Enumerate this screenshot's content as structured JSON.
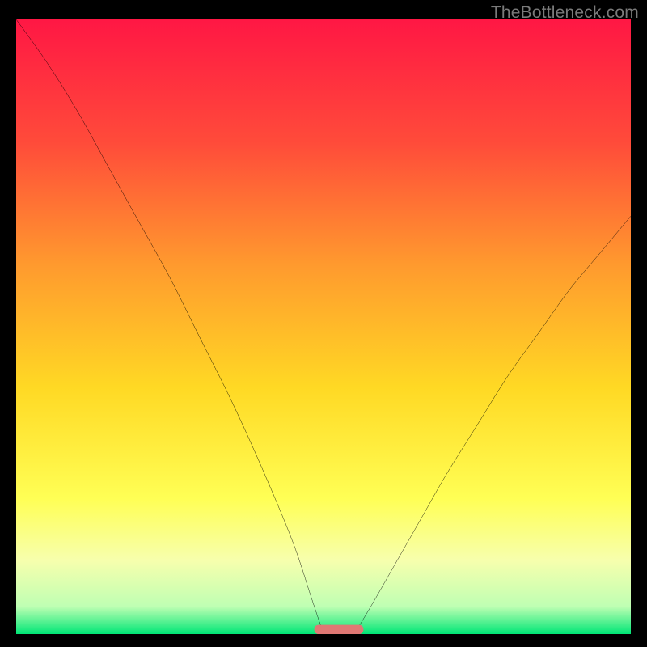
{
  "watermark": "TheBottleneck.com",
  "chart_data": {
    "type": "line",
    "title": "",
    "xlabel": "",
    "ylabel": "",
    "xlim": [
      0,
      100
    ],
    "ylim": [
      0,
      100
    ],
    "background_gradient": {
      "stops": [
        {
          "offset": 0.0,
          "color": "#ff1744"
        },
        {
          "offset": 0.2,
          "color": "#ff4b3a"
        },
        {
          "offset": 0.4,
          "color": "#ff9a2e"
        },
        {
          "offset": 0.6,
          "color": "#ffd924"
        },
        {
          "offset": 0.78,
          "color": "#ffff55"
        },
        {
          "offset": 0.88,
          "color": "#f7ffad"
        },
        {
          "offset": 0.955,
          "color": "#bfffb3"
        },
        {
          "offset": 1.0,
          "color": "#00e676"
        }
      ]
    },
    "annotations": [],
    "series": [
      {
        "name": "left-curve",
        "type": "line",
        "x": [
          0,
          5,
          10,
          15,
          20,
          25,
          30,
          35,
          40,
          45,
          48,
          50
        ],
        "values": [
          100,
          93,
          85,
          76,
          67,
          58,
          48,
          38,
          27,
          15,
          6,
          0
        ]
      },
      {
        "name": "right-curve",
        "type": "line",
        "x": [
          55,
          58,
          62,
          66,
          70,
          75,
          80,
          85,
          90,
          95,
          100
        ],
        "values": [
          0,
          5,
          12,
          19,
          26,
          34,
          42,
          49,
          56,
          62,
          68
        ]
      }
    ],
    "notch": {
      "name": "bottom-notch",
      "x_center": 52.5,
      "half_width": 4,
      "height": 1.5,
      "color": "#e07874"
    }
  }
}
